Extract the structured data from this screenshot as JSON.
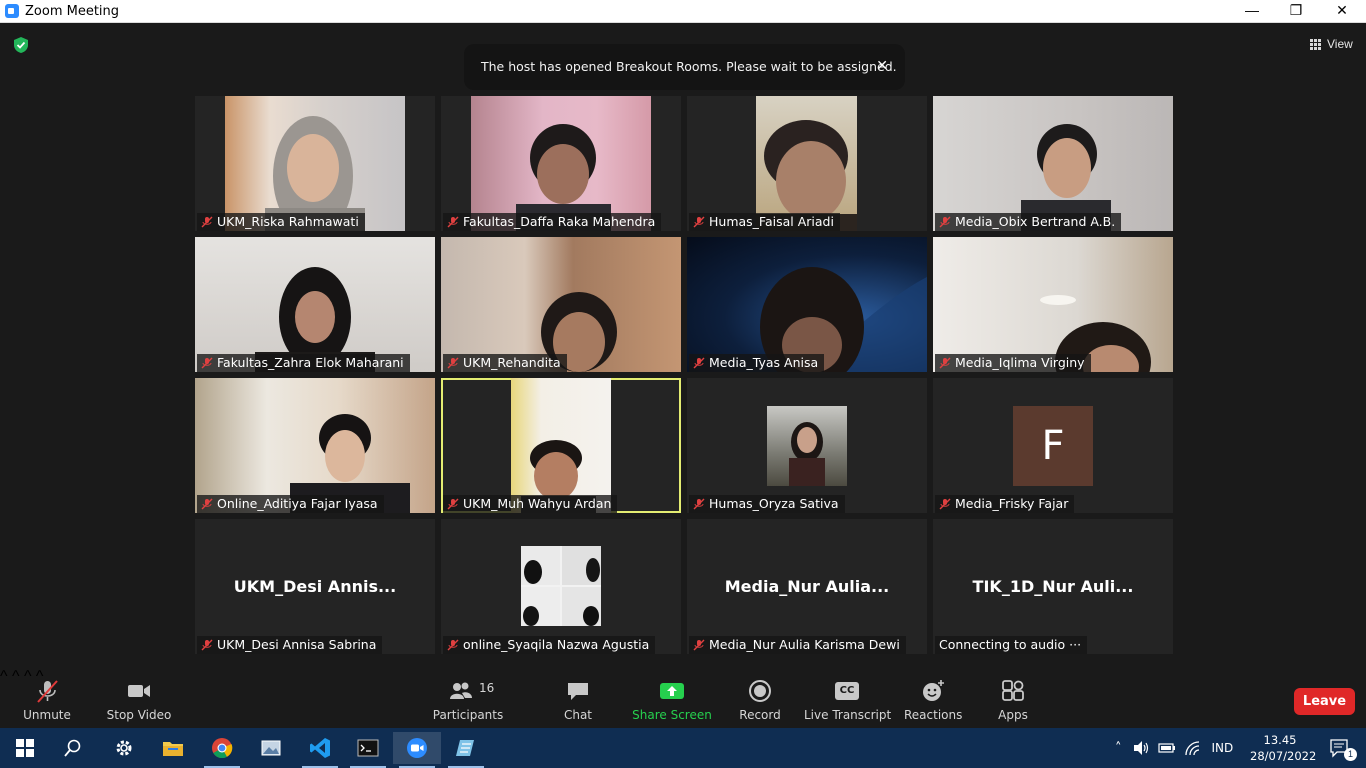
{
  "window": {
    "title": "Zoom Meeting",
    "minimize": "—",
    "restore": "❐",
    "close": "✕"
  },
  "top": {
    "view_label": "View",
    "banner_text": "The host has opened Breakout Rooms. Please wait to be assigned.",
    "banner_close": "✕"
  },
  "tiles": [
    {
      "name": "UKM_Riska Rahmawati"
    },
    {
      "name": "Fakultas_Daffa Raka Mahendra"
    },
    {
      "name": "Humas_Faisal Ariadi"
    },
    {
      "name": "Media_Obix Bertrand A.B."
    },
    {
      "name": "Fakultas_Zahra Elok Maharani"
    },
    {
      "name": "UKM_Rehandita"
    },
    {
      "name": "Media_Tyas Anisa"
    },
    {
      "name": "Media_Iqlima Virginy"
    },
    {
      "name": "Online_Aditiya Fajar Iyasa"
    },
    {
      "name": "UKM_Muh Wahyu Ardan"
    },
    {
      "name": "Humas_Oryza Sativa"
    },
    {
      "name": "Media_Frisky Fajar",
      "avatar_letter": "F"
    },
    {
      "name": "UKM_Desi Annisa Sabrina",
      "big_name": "UKM_Desi  Annis..."
    },
    {
      "name": "online_Syaqila Nazwa Agustia"
    },
    {
      "name": "Media_Nur Aulia Karisma Dewi",
      "big_name": "Media_Nur  Aulia..."
    },
    {
      "name": "Connecting to audio ···",
      "big_name": "TIK_1D_Nur  Auli..."
    }
  ],
  "toolbar": {
    "unmute": "Unmute",
    "stop_video": "Stop Video",
    "participants": "Participants",
    "participants_count": "16",
    "chat": "Chat",
    "share_screen": "Share Screen",
    "record": "Record",
    "live_transcript": "Live Transcript",
    "reactions": "Reactions",
    "apps": "Apps",
    "leave": "Leave",
    "cc_badge": "CC",
    "caret": "^"
  },
  "taskbar": {
    "language": "IND",
    "time": "13.45",
    "date": "28/07/2022",
    "notification_count": "1"
  },
  "colors": {
    "share_green": "#26d04e",
    "leave_red": "#e02828",
    "active_speaker": "#e4ed72",
    "taskbar_bg": "#0f2d52"
  }
}
